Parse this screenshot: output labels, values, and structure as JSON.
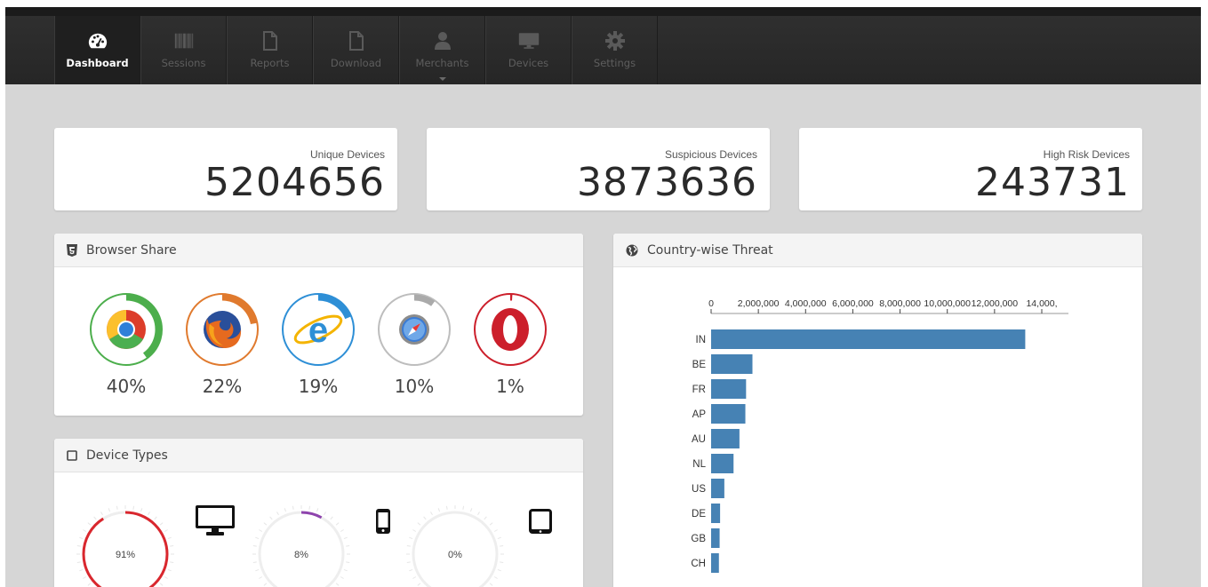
{
  "nav": {
    "items": [
      {
        "label": "Dashboard",
        "icon": "dashboard-gauge-icon",
        "active": true
      },
      {
        "label": "Sessions",
        "icon": "barcode-icon",
        "active": false
      },
      {
        "label": "Reports",
        "icon": "document-icon",
        "active": false
      },
      {
        "label": "Download",
        "icon": "document-icon",
        "active": false
      },
      {
        "label": "Merchants",
        "icon": "user-icon",
        "active": false
      },
      {
        "label": "Devices",
        "icon": "monitor-icon",
        "active": false
      },
      {
        "label": "Settings",
        "icon": "gear-icon",
        "active": false
      }
    ]
  },
  "stats": [
    {
      "label": "Unique Devices",
      "value": "5204656"
    },
    {
      "label": "Suspicious Devices",
      "value": "3873636"
    },
    {
      "label": "High Risk Devices",
      "value": "243731"
    }
  ],
  "browser_share": {
    "title": "Browser Share",
    "icon": "html5-icon",
    "browsers": [
      {
        "name": "Chrome",
        "icon": "chrome-icon",
        "pct": "40%",
        "value": 0.4,
        "color": "#4cae4c"
      },
      {
        "name": "Firefox",
        "icon": "firefox-icon",
        "pct": "22%",
        "value": 0.22,
        "color": "#e07a2e"
      },
      {
        "name": "Internet Explorer",
        "icon": "internet-explorer-icon",
        "pct": "19%",
        "value": 0.19,
        "color": "#2e8fd6"
      },
      {
        "name": "Safari",
        "icon": "safari-icon",
        "pct": "10%",
        "value": 0.1,
        "color": "#aaaaaa"
      },
      {
        "name": "Opera",
        "icon": "opera-icon",
        "pct": "1%",
        "value": 0.01,
        "color": "#cc1f2b"
      }
    ]
  },
  "device_types": {
    "title": "Device Types",
    "icon": "tablet-outline-icon",
    "devices": [
      {
        "name": "Desktop",
        "icon": "desktop-icon",
        "pct": "91%",
        "value": 0.91,
        "color": "#d9272e"
      },
      {
        "name": "Mobile",
        "icon": "mobile-phone-icon",
        "pct": "8%",
        "value": 0.08,
        "color": "#8e44ad"
      },
      {
        "name": "Tablet",
        "icon": "tablet-icon",
        "pct": "0%",
        "value": 0.0,
        "color": "#cccccc"
      }
    ]
  },
  "country_threat": {
    "title": "Country-wise Threat",
    "icon": "globe-icon"
  },
  "chart_data": {
    "type": "bar",
    "orientation": "horizontal",
    "title": "",
    "xlabel": "",
    "ylabel": "",
    "categories": [
      "IN",
      "BE",
      "FR",
      "AP",
      "AU",
      "NL",
      "US",
      "DE",
      "GB",
      "CH"
    ],
    "values": [
      13300000,
      1750000,
      1480000,
      1450000,
      1200000,
      950000,
      560000,
      380000,
      360000,
      330000
    ],
    "xlim": [
      0,
      14000000
    ],
    "tick_labels": [
      "0",
      "2,000,000",
      "4,000,000",
      "6,000,000",
      "8,000,000",
      "10,000,000",
      "12,000,000",
      "14,000,"
    ],
    "bar_color": "#4682b4",
    "grid": false
  }
}
